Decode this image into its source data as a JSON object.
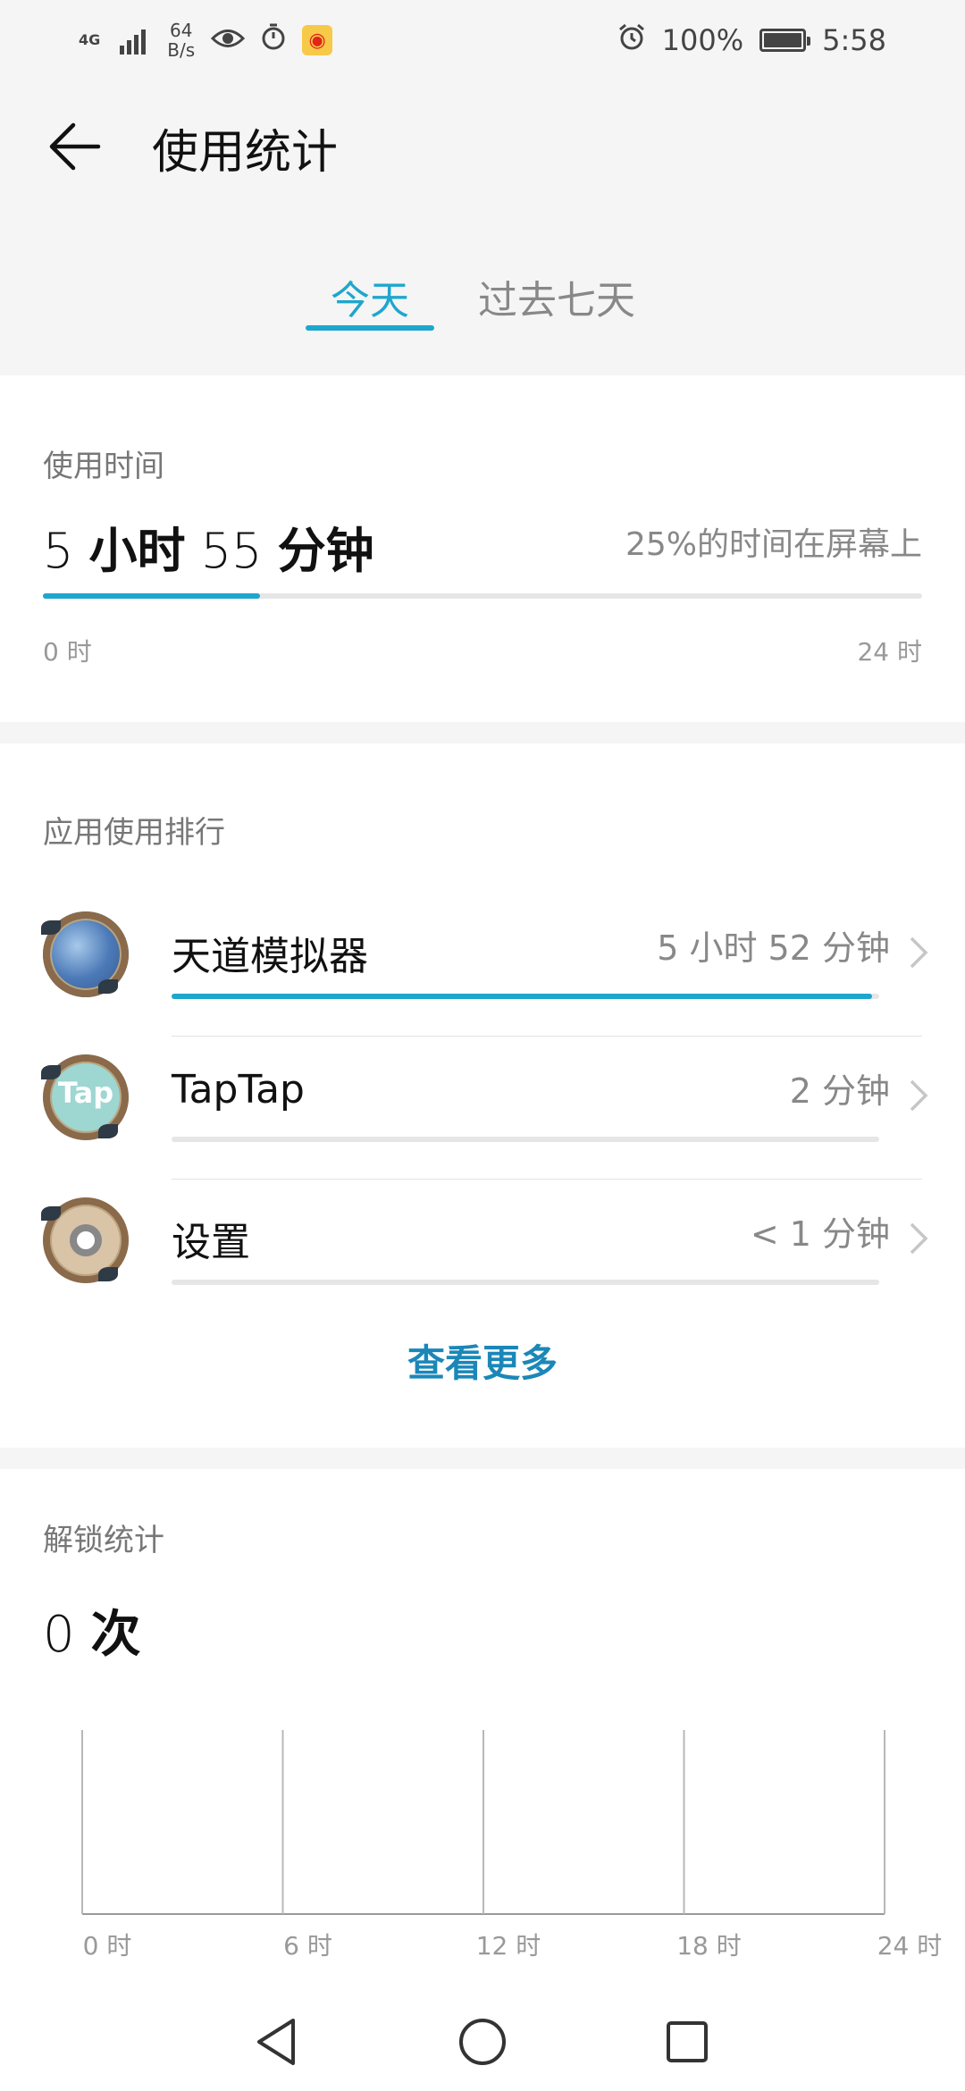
{
  "status_bar": {
    "network": "4G",
    "speed_value": "64",
    "speed_unit": "B/s",
    "battery": "100%",
    "time": "5:58"
  },
  "header": {
    "title": "使用统计"
  },
  "tabs": [
    {
      "label": "今天",
      "active": true
    },
    {
      "label": "过去七天",
      "active": false
    }
  ],
  "usage": {
    "section_label": "使用时间",
    "hours": "5",
    "hours_unit": "小时",
    "minutes": "55",
    "minutes_unit": "分钟",
    "percent_text": "25%的时间在屏幕上",
    "fraction_of_day": 0.247,
    "axis_start": "0 时",
    "axis_end": "24 时"
  },
  "apps": {
    "section_label": "应用使用排行",
    "items": [
      {
        "name": "天道模拟器",
        "duration": "5 小时 52 分钟",
        "fraction": 0.99
      },
      {
        "name": "TapTap",
        "duration": "2 分钟",
        "fraction": 0.0
      },
      {
        "name": "设置",
        "duration": "< 1 分钟",
        "fraction": 0.0
      }
    ],
    "more_label": "查看更多"
  },
  "unlock": {
    "section_label": "解锁统计",
    "count": "0",
    "count_unit": "次"
  },
  "chart_data": {
    "type": "bar",
    "categories": [
      "0 时",
      "6 时",
      "12 时",
      "18 时",
      "24 时"
    ],
    "x_ticks": [
      0,
      6,
      12,
      18,
      24
    ],
    "values": [],
    "xlim": [
      0,
      24
    ],
    "grid": true
  },
  "colors": {
    "accent": "#1ea6cf",
    "link": "#1b87b8",
    "track": "#e6e6e6"
  },
  "icons": [
    "back-arrow-icon",
    "signal-icon",
    "eye-icon",
    "timer-icon",
    "weibo-icon",
    "alarm-icon",
    "battery-icon",
    "chevron-right-icon",
    "nav-back-icon",
    "nav-home-icon",
    "nav-recents-icon"
  ]
}
